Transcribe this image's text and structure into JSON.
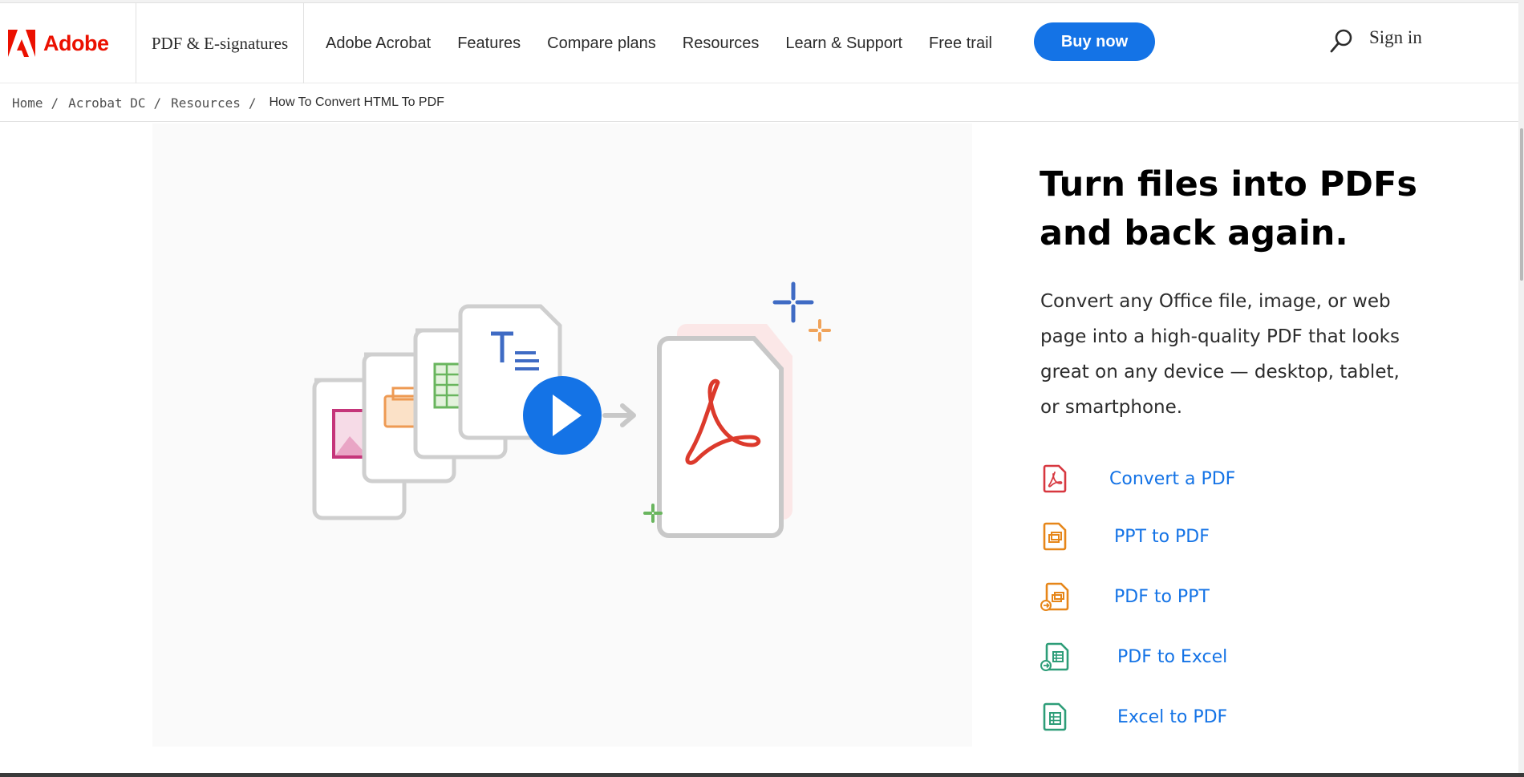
{
  "brand": {
    "name": "Adobe",
    "color": "#eb1000"
  },
  "header": {
    "product_label": "PDF & E-signatures",
    "nav": [
      "Adobe Acrobat",
      "Features",
      "Compare plans",
      "Resources",
      "Learn & Support",
      "Free trail"
    ],
    "buy_label": "Buy now",
    "signin_label": "Sign in",
    "accent": "#1473e6"
  },
  "breadcrumb": {
    "items": [
      "Home",
      "Acrobat DC",
      "Resources"
    ],
    "separator": "/",
    "current": "How To Convert HTML To PDF"
  },
  "hero": {
    "illustration": "documents-converting-to-pdf",
    "play_icon": "play-icon"
  },
  "content": {
    "title_line1": "Turn files into PDFs",
    "title_line2": "and back again.",
    "description": "Convert any Office file, image, or web page into a high-quality PDF that looks great on any device — desktop, tablet, or smartphone.",
    "links": [
      {
        "label": "Convert a PDF",
        "icon": "pdf-file-icon",
        "color": "#d7373f"
      },
      {
        "label": "PPT to PDF",
        "icon": "ppt-file-icon",
        "color": "#e68619"
      },
      {
        "label": "PDF to PPT",
        "icon": "pdf-to-ppt-icon",
        "color": "#e68619"
      },
      {
        "label": "PDF to Excel",
        "icon": "pdf-to-excel-icon",
        "color": "#2d9d78"
      },
      {
        "label": "Excel to PDF",
        "icon": "excel-file-icon",
        "color": "#2d9d78"
      }
    ]
  }
}
